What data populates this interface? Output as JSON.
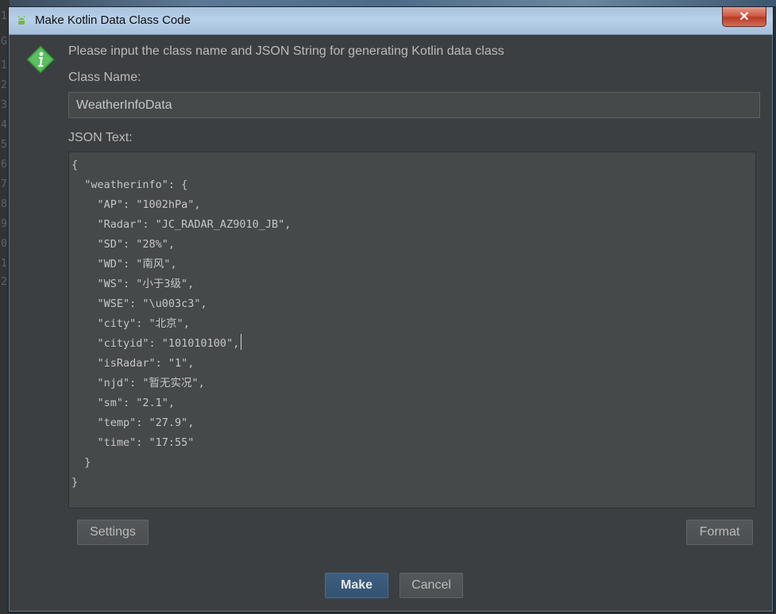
{
  "window": {
    "title": "Make Kotlin Data Class Code",
    "close_glyph": "✕"
  },
  "gutter": {
    "glyphs": [
      "1",
      "G",
      "1",
      "2",
      "3",
      "4",
      "5",
      "6",
      "7",
      "8",
      "9",
      "0",
      "1",
      "2"
    ]
  },
  "prompt": "Please input the class name and JSON String for generating Kotlin data class",
  "class_name": {
    "label": "Class Name:",
    "value": "WeatherInfoData"
  },
  "json": {
    "label": "JSON Text:",
    "lines": [
      "{",
      "  \"weatherinfo\": {",
      "    \"AP\": \"1002hPa\",",
      "    \"Radar\": \"JC_RADAR_AZ9010_JB\",",
      "    \"SD\": \"28%\",",
      "    \"WD\": \"南风\",",
      "    \"WS\": \"小于3级\",",
      "    \"WSE\": \"\\u003c3\",",
      "    \"city\": \"北京\",",
      "    \"cityid\": \"101010100\",",
      "    \"isRadar\": \"1\",",
      "    \"njd\": \"暂无实况\",",
      "    \"sm\": \"2.1\",",
      "    \"temp\": \"27.9\",",
      "    \"time\": \"17:55\"",
      "  }",
      "}"
    ]
  },
  "buttons": {
    "settings": "Settings",
    "format": "Format",
    "make": "Make",
    "cancel": "Cancel"
  },
  "icons": {
    "title_icon": "android-icon",
    "info_icon": "info-diamond-icon",
    "close_icon": "close-icon"
  },
  "colors": {
    "dialog_bg": "#3c3f41",
    "input_bg": "#45494a",
    "text": "#bbbbbb",
    "primary_button": "#365880",
    "info_icon": "#4caf50",
    "close_button": "#c7442f"
  }
}
